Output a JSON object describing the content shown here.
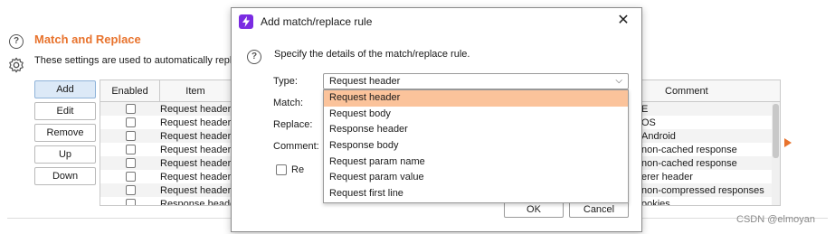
{
  "settings": {
    "title": "Match and Replace",
    "description": "These settings are used to automatically repla",
    "buttons": {
      "add": "Add",
      "edit": "Edit",
      "remove": "Remove",
      "up": "Up",
      "down": "Down"
    },
    "table": {
      "col_enabled": "Enabled",
      "col_item": "Item",
      "col_comment": "Comment",
      "items": [
        "Request header",
        "Request header",
        "Request header",
        "Request header",
        "Request header",
        "Request header",
        "Request header",
        "Response heade"
      ],
      "comments": [
        "E",
        "OS",
        "Android",
        "non-cached response",
        "non-cached response",
        "erer header",
        "non-compressed responses",
        "ookies"
      ]
    }
  },
  "dialog": {
    "title": "Add match/replace rule",
    "description": "Specify the details of the match/replace rule.",
    "type_label": "Type:",
    "type_value": "Request header",
    "match_label": "Match:",
    "replace_label": "Replace:",
    "comment_label": "Comment:",
    "regex_label": "Regex m",
    "ok": "OK",
    "cancel": "Cancel",
    "options": [
      "Request header",
      "Request body",
      "Response header",
      "Response body",
      "Request param name",
      "Request param value",
      "Request first line"
    ],
    "selected_index": 0
  },
  "icons": {
    "help": "help-circle-icon",
    "settings": "gear-icon",
    "app": "burp-lightning-icon",
    "close": "close-icon",
    "chevron": "chevron-down-icon"
  },
  "colors": {
    "accent": "#e8732d",
    "selection": "#fbc39b",
    "app_icon": "#7a2be2"
  },
  "watermark": "CSDN @elmoyan"
}
